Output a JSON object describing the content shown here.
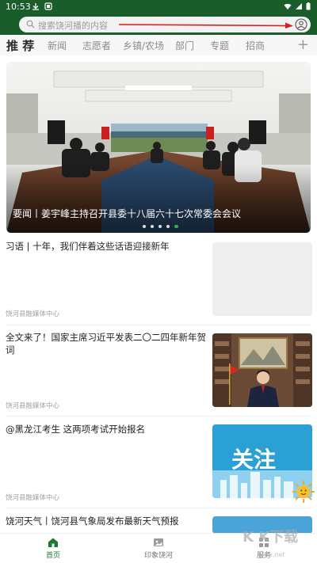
{
  "status_bar": {
    "time": "10:53"
  },
  "search": {
    "placeholder": "搜索饶河播的内容"
  },
  "tabs": [
    {
      "label": "推 荐",
      "active": true
    },
    {
      "label": "新闻"
    },
    {
      "label": "志愿者"
    },
    {
      "label": "乡镇/农场"
    },
    {
      "label": "部门"
    },
    {
      "label": "专题"
    },
    {
      "label": "招商"
    }
  ],
  "banner": {
    "caption": "要闻丨姜宇峰主持召开县委十八届六十七次常委会会议",
    "dot_count": 5,
    "active_dot": 4
  },
  "news": [
    {
      "title": "习语 | 十年，我们伴着这些话语迎接新年",
      "source": "饶河县融媒体中心",
      "thumb": "blank"
    },
    {
      "title": "全文来了！国家主席习近平发表二〇二四年新年贺词",
      "source": "饶河县融媒体中心",
      "thumb": "speech"
    },
    {
      "title": "@黑龙江考生 这两项考试开始报名",
      "source": "饶河县融媒体中心",
      "thumb": "guanzhu",
      "thumb_text": "关注"
    },
    {
      "title": "饶河天气丨饶河县气象局发布最新天气预报",
      "source": "",
      "thumb": "weather"
    }
  ],
  "bottom_nav": [
    {
      "label": "首页",
      "icon": "home-icon",
      "active": true
    },
    {
      "label": "印象饶河",
      "icon": "image-icon"
    },
    {
      "label": "服务",
      "icon": "service-icon"
    }
  ],
  "watermark": {
    "text": "K K下载",
    "sub": "kkx.net"
  },
  "colors": {
    "header": "#1a5c2a",
    "accent": "#1a7a35",
    "arrow": "#d42020"
  }
}
